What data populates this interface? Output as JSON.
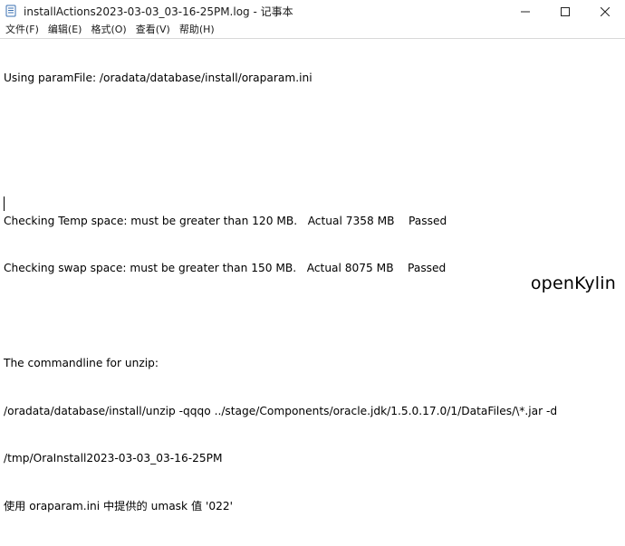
{
  "window": {
    "title": "installActions2023-03-03_03-16-25PM.log - 记事本",
    "app_icon": "notepad-icon",
    "controls": {
      "minimize_icon": "minimize-icon",
      "maximize_icon": "maximize-icon",
      "close_icon": "close-icon"
    }
  },
  "menu": {
    "items": [
      {
        "label": "文件(F)"
      },
      {
        "label": "编辑(E)"
      },
      {
        "label": "格式(O)"
      },
      {
        "label": "查看(V)"
      },
      {
        "label": "帮助(H)"
      }
    ]
  },
  "editor": {
    "lines": [
      "Using paramFile: /oradata/database/install/oraparam.ini",
      "",
      "",
      "Checking Temp space: must be greater than 120 MB.   Actual 7358 MB    Passed",
      "Checking swap space: must be greater than 150 MB.   Actual 8075 MB    Passed",
      "",
      "The commandline for unzip:",
      "/oradata/database/install/unzip -qqqo ../stage/Components/oracle.jdk/1.5.0.17.0/1/DataFiles/\\*.jar -d",
      "/tmp/OraInstall2023-03-03_03-16-25PM",
      "使用 oraparam.ini 中提供的 umask 值 '022'"
    ]
  },
  "watermark": {
    "text": "openKylin"
  }
}
